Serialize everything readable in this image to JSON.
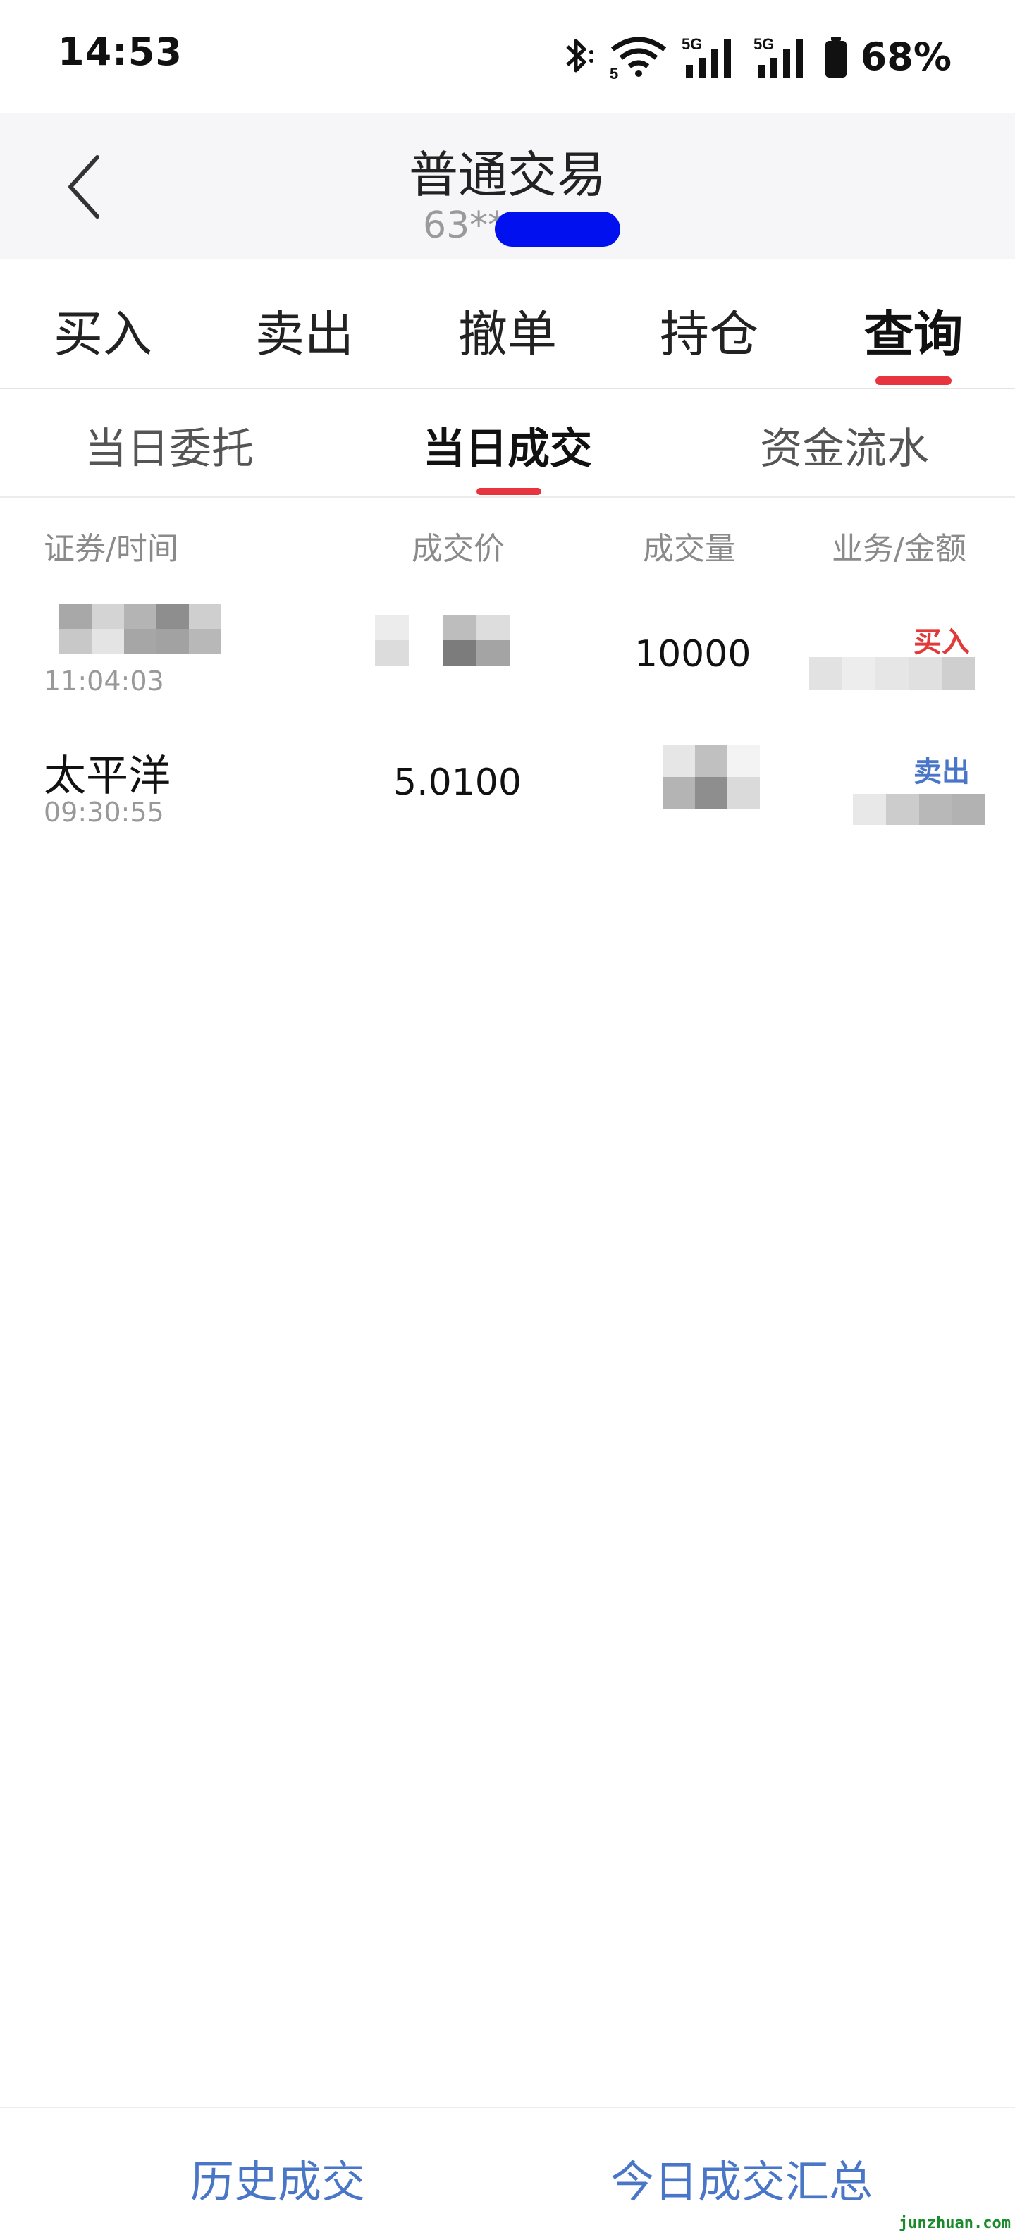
{
  "status_bar": {
    "time": "14:53",
    "battery": "68%",
    "icons": [
      "bluetooth-icon",
      "wifi-icon",
      "signal-5g-icon",
      "signal-5g-icon",
      "battery-icon"
    ]
  },
  "header": {
    "title": "普通交易",
    "account_prefix": "63**",
    "back_icon": "chevron-left-icon"
  },
  "main_tabs": [
    "买入",
    "卖出",
    "撤单",
    "持仓",
    "查询"
  ],
  "active_main_tab": "查询",
  "sub_tabs": [
    "当日委托",
    "当日成交",
    "资金流水"
  ],
  "active_sub_tab": "当日成交",
  "table": {
    "columns": [
      "证券/时间",
      "成交价",
      "成交量",
      "业务/金额"
    ],
    "rows": [
      {
        "name": "",
        "time": "11:04:03",
        "price": "",
        "volume": "10000",
        "business": "买入",
        "amount": ""
      },
      {
        "name": "太平洋",
        "time": "09:30:55",
        "price": "5.0100",
        "volume": "",
        "business": "卖出",
        "amount": ""
      }
    ]
  },
  "bottom_bar": {
    "history_label": "历史成交",
    "summary_label": "今日成交汇总"
  },
  "watermark": "junzhuan.com",
  "colors": {
    "accent_red": "#e8343f",
    "buy_red": "#e03a3a",
    "sell_blue": "#4a76c7",
    "link_blue": "#4a76c7"
  }
}
